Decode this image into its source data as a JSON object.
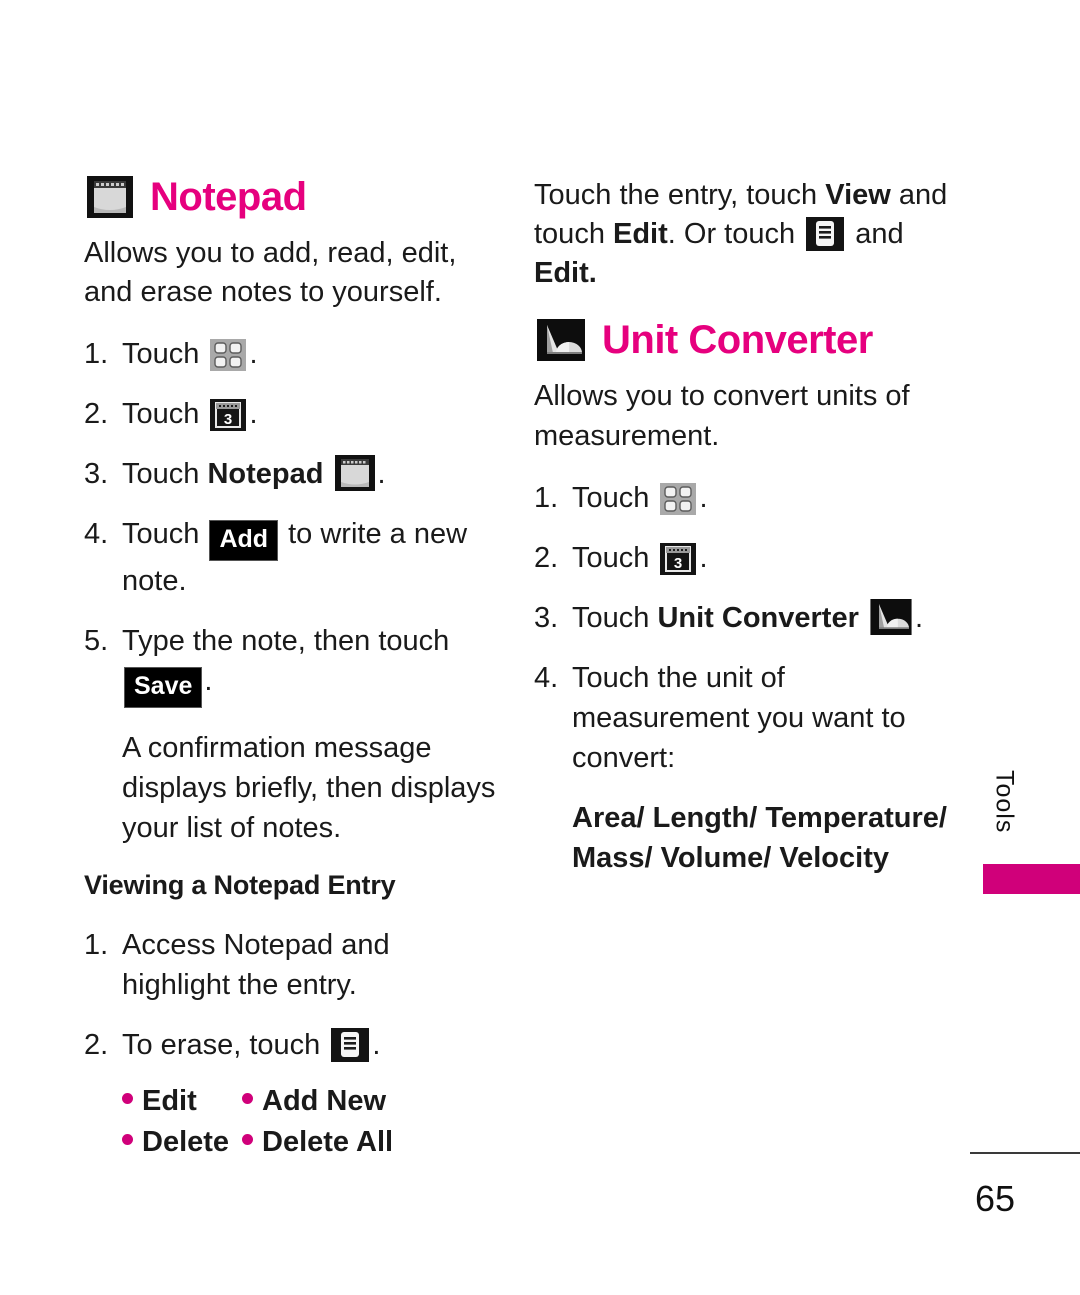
{
  "page": {
    "number": "65",
    "side_tab_label": "Tools",
    "accent_color": "#D0007A",
    "heading_color": "#E6007E"
  },
  "left_column": {
    "heading": {
      "title": "Notepad",
      "icon": "notepad-icon"
    },
    "intro": "Allows you to add, read, edit, and erase notes to yourself.",
    "steps": [
      {
        "num": "1.",
        "pre": "Touch",
        "icon": "grid-menu-icon",
        "post": "."
      },
      {
        "num": "2.",
        "pre": "Touch",
        "icon": "tools-3-icon",
        "post": "."
      },
      {
        "num": "3.",
        "pre": "Touch",
        "bold": "Notepad",
        "icon": "notepad-icon",
        "post": "."
      },
      {
        "num": "4.",
        "pre": "Touch",
        "button": "Add",
        "post": "to write a new note."
      },
      {
        "num": "5.",
        "pre": "Type the note, then touch",
        "button": "Save",
        "post": "."
      }
    ],
    "confirmation_note": "A confirmation message displays briefly, then displays your list of notes.",
    "subheading": "Viewing a Notepad Entry",
    "view_steps": [
      {
        "num": "1.",
        "text": "Access Notepad and highlight the entry."
      },
      {
        "num": "2.",
        "pre": "To erase, touch",
        "icon": "options-list-icon",
        "post": "."
      }
    ],
    "bullets": [
      [
        "Edit",
        "Add New"
      ],
      [
        "Delete",
        "Delete All"
      ]
    ]
  },
  "right_column": {
    "continued_paragraph": {
      "part1": "Touch the entry, touch ",
      "bold1": "View",
      "part2": " and touch ",
      "bold2": "Edit",
      "part3": ". Or touch ",
      "icon": "options-list-icon",
      "part4": " and ",
      "bold3": "Edit."
    },
    "heading": {
      "title": "Unit Converter",
      "icon": "unit-converter-icon"
    },
    "intro": "Allows you to convert units of measurement.",
    "steps": [
      {
        "num": "1.",
        "pre": "Touch",
        "icon": "grid-menu-icon",
        "post": "."
      },
      {
        "num": "2.",
        "pre": "Touch",
        "icon": "tools-3-icon",
        "post": "."
      },
      {
        "num": "3.",
        "pre": "Touch",
        "bold": "Unit Converter",
        "icon": "unit-converter-icon",
        "post": "."
      },
      {
        "num": "4.",
        "text": "Touch the unit of measurement you want to convert:"
      }
    ],
    "unit_list_line1": "Area/ Length/ Temperature/",
    "unit_list_line2": "Mass/ Volume/ Velocity"
  }
}
